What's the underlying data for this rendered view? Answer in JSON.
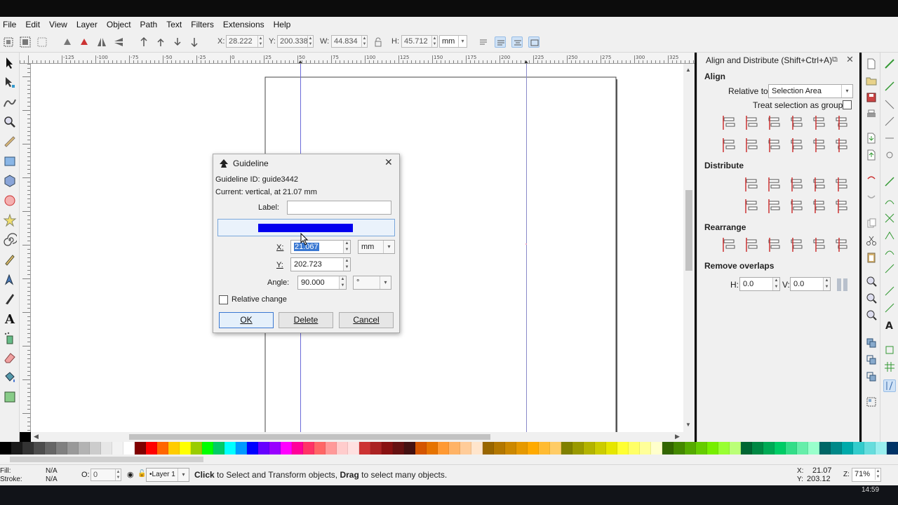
{
  "menu": [
    "File",
    "Edit",
    "View",
    "Layer",
    "Object",
    "Path",
    "Text",
    "Filters",
    "Extensions",
    "Help"
  ],
  "controls": {
    "x_label": "X:",
    "x_value": "28.222",
    "y_label": "Y:",
    "y_value": "200.338",
    "w_label": "W:",
    "w_value": "44.834",
    "h_label": "H:",
    "h_value": "45.712",
    "unit": "mm"
  },
  "ruler_h_labels": [
    "-125",
    "-100",
    "-75",
    "-50",
    "-25",
    "0",
    "25",
    "50",
    "75",
    "100",
    "125",
    "150",
    "175",
    "200",
    "225",
    "250",
    "275",
    "300",
    "325",
    "350"
  ],
  "ruler_v_labels": [
    "0",
    "25",
    "50",
    "75",
    "100",
    "125",
    "150",
    "175",
    "200"
  ],
  "panel": {
    "title": "Align and Distribute (Shift+Ctrl+A)",
    "align_title": "Align",
    "relative_label": "Relative to:",
    "relative_value": "Selection Area",
    "treat_group_label": "Treat selection as group:",
    "distribute_title": "Distribute",
    "rearrange_title": "Rearrange",
    "remove_overlaps_title": "Remove overlaps",
    "h_label": "H:",
    "h_value": "0.0",
    "v_label": "V:",
    "v_value": "0.0"
  },
  "dialog": {
    "title": "Guideline",
    "guide_id": "Guideline ID: guide3442",
    "current": "Current: vertical, at 21.07 mm",
    "label_caption": "Label:",
    "label_value": "",
    "color_swatch": "#0000ee",
    "x_label": "X:",
    "x_value": "21.067",
    "x_unit": "mm",
    "y_label": "Y:",
    "y_value": "202.723",
    "angle_label": "Angle:",
    "angle_value": "90.000",
    "angle_unit": "°",
    "relative_change": "Relative change",
    "ok": "OK",
    "delete": "Delete",
    "cancel": "Cancel"
  },
  "status": {
    "fill_label": "Fill:",
    "fill_value": "N/A",
    "stroke_label": "Stroke:",
    "stroke_value": "N/A",
    "opacity_label": "O:",
    "opacity_value": "0",
    "layer": "•Layer 1",
    "message_bold1": "Click",
    "message_text1": " to Select and Transform objects, ",
    "message_bold2": "Drag",
    "message_text2": " to select many objects.",
    "coord_x_label": "X:",
    "coord_x": "21.07",
    "coord_y_label": "Y:",
    "coord_y": "203.12",
    "zoom_label": "Z:",
    "zoom": "71%",
    "clock": "14:59"
  },
  "palette": [
    "#000000",
    "#1a1a1a",
    "#333333",
    "#4d4d4d",
    "#666666",
    "#808080",
    "#999999",
    "#b3b3b3",
    "#cccccc",
    "#e6e6e6",
    "#f2f2f2",
    "#ffffff",
    "#800000",
    "#ff0000",
    "#ff6600",
    "#ffcc00",
    "#ffff00",
    "#99cc00",
    "#00ff00",
    "#00cc66",
    "#00ffff",
    "#0099ff",
    "#0000ff",
    "#6600ff",
    "#9900ff",
    "#ff00ff",
    "#ff0099",
    "#ff3366",
    "#ff6666",
    "#ff9999",
    "#ffcccc",
    "#ffe0e0",
    "#cc3333",
    "#aa2222",
    "#881111",
    "#661111",
    "#441111",
    "#d45500",
    "#e67300",
    "#ff9933",
    "#ffb366",
    "#ffcc99",
    "#ffe5cc",
    "#996600",
    "#b37700",
    "#cc8800",
    "#e69900",
    "#ffaa00",
    "#ffbb33",
    "#ffcc66",
    "#808000",
    "#999900",
    "#b3b300",
    "#cccc00",
    "#e6e600",
    "#ffff33",
    "#ffff66",
    "#ffff99",
    "#ffffcc",
    "#336600",
    "#448800",
    "#55aa00",
    "#66cc00",
    "#77ee00",
    "#99ff33",
    "#bbff77",
    "#006633",
    "#008844",
    "#00aa55",
    "#00cc66",
    "#33dd88",
    "#66eeaa",
    "#99ffcc",
    "#006666",
    "#008888",
    "#00aaaa",
    "#33cccc",
    "#66dddd",
    "#99eeee",
    "#003366",
    "#004488",
    "#0055aa",
    "#3377cc",
    "#6699dd",
    "#99bbee",
    "#330066",
    "#440088",
    "#5500aa",
    "#7733cc",
    "#9966dd",
    "#bb99ee",
    "#660033",
    "#880044",
    "#aa0055",
    "#cc3377",
    "#dd6699",
    "#ee99bb",
    "#553300",
    "#774400",
    "#996633",
    "#bb8855",
    "#ddbb99",
    "#333300",
    "#555511",
    "#777733"
  ]
}
